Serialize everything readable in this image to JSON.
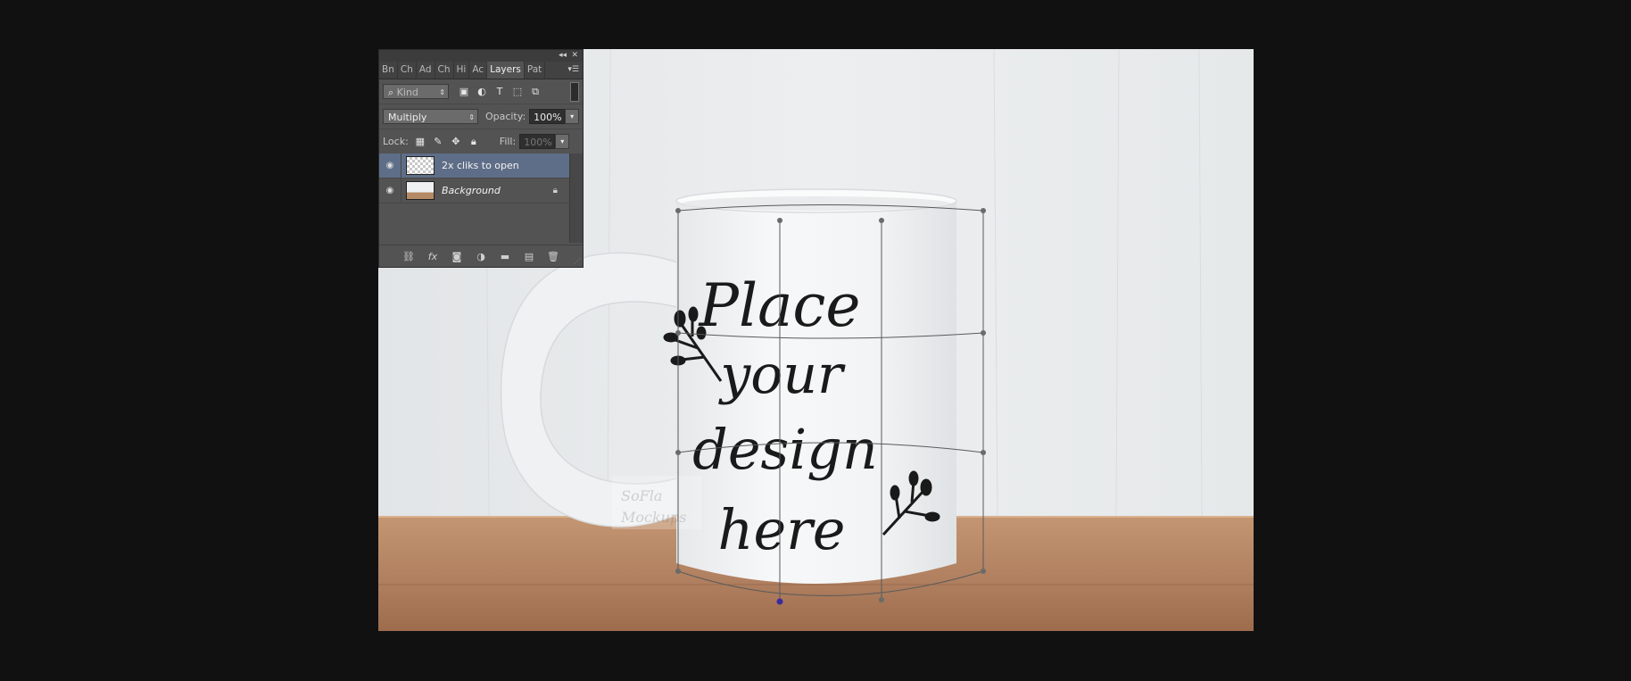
{
  "colors": {
    "background": "#111111",
    "panel": "#535353",
    "selected_layer": "#5f6e88",
    "wall": "#e8ebec",
    "shelf": "#b48562",
    "mug": "#f4f5f6",
    "design_ink": "#1a1a1a",
    "mesh_line": "#555555"
  },
  "panel": {
    "collapse_icon": "double-chevron-left-icon",
    "close_icon": "close-icon",
    "tabs": [
      "Bn",
      "Ch",
      "Ad",
      "Ch",
      "Hi",
      "Ac",
      "Layers",
      "Pat"
    ],
    "active_tab": "Layers",
    "menu_icon": "panel-menu-icon",
    "filter": {
      "kind_label": "Kind",
      "icons": [
        "image-filter-icon",
        "adjustment-filter-icon",
        "type-filter-icon",
        "shape-filter-icon",
        "smart-object-filter-icon"
      ]
    },
    "blend": {
      "mode": "Multiply",
      "opacity_label": "Opacity:",
      "opacity_value": "100%"
    },
    "lock": {
      "lock_label": "Lock:",
      "icons": [
        "lock-transparent-icon",
        "lock-paint-icon",
        "lock-move-icon",
        "lock-all-icon"
      ],
      "fill_label": "Fill:",
      "fill_value": "100%"
    },
    "layers": [
      {
        "name": "2x cliks to open",
        "selected": true,
        "visible": true,
        "locked": false
      },
      {
        "name": "Background",
        "selected": false,
        "visible": true,
        "locked": true
      }
    ],
    "footer_icons": [
      "link-layers-icon",
      "fx-icon",
      "layer-mask-icon",
      "adjustment-layer-icon",
      "group-folder-icon",
      "new-layer-icon",
      "trash-icon"
    ]
  },
  "mockup": {
    "design_lines": [
      "Place",
      "your",
      "design",
      "here"
    ],
    "watermark_lines": [
      "SoFla",
      "Mockups"
    ]
  }
}
